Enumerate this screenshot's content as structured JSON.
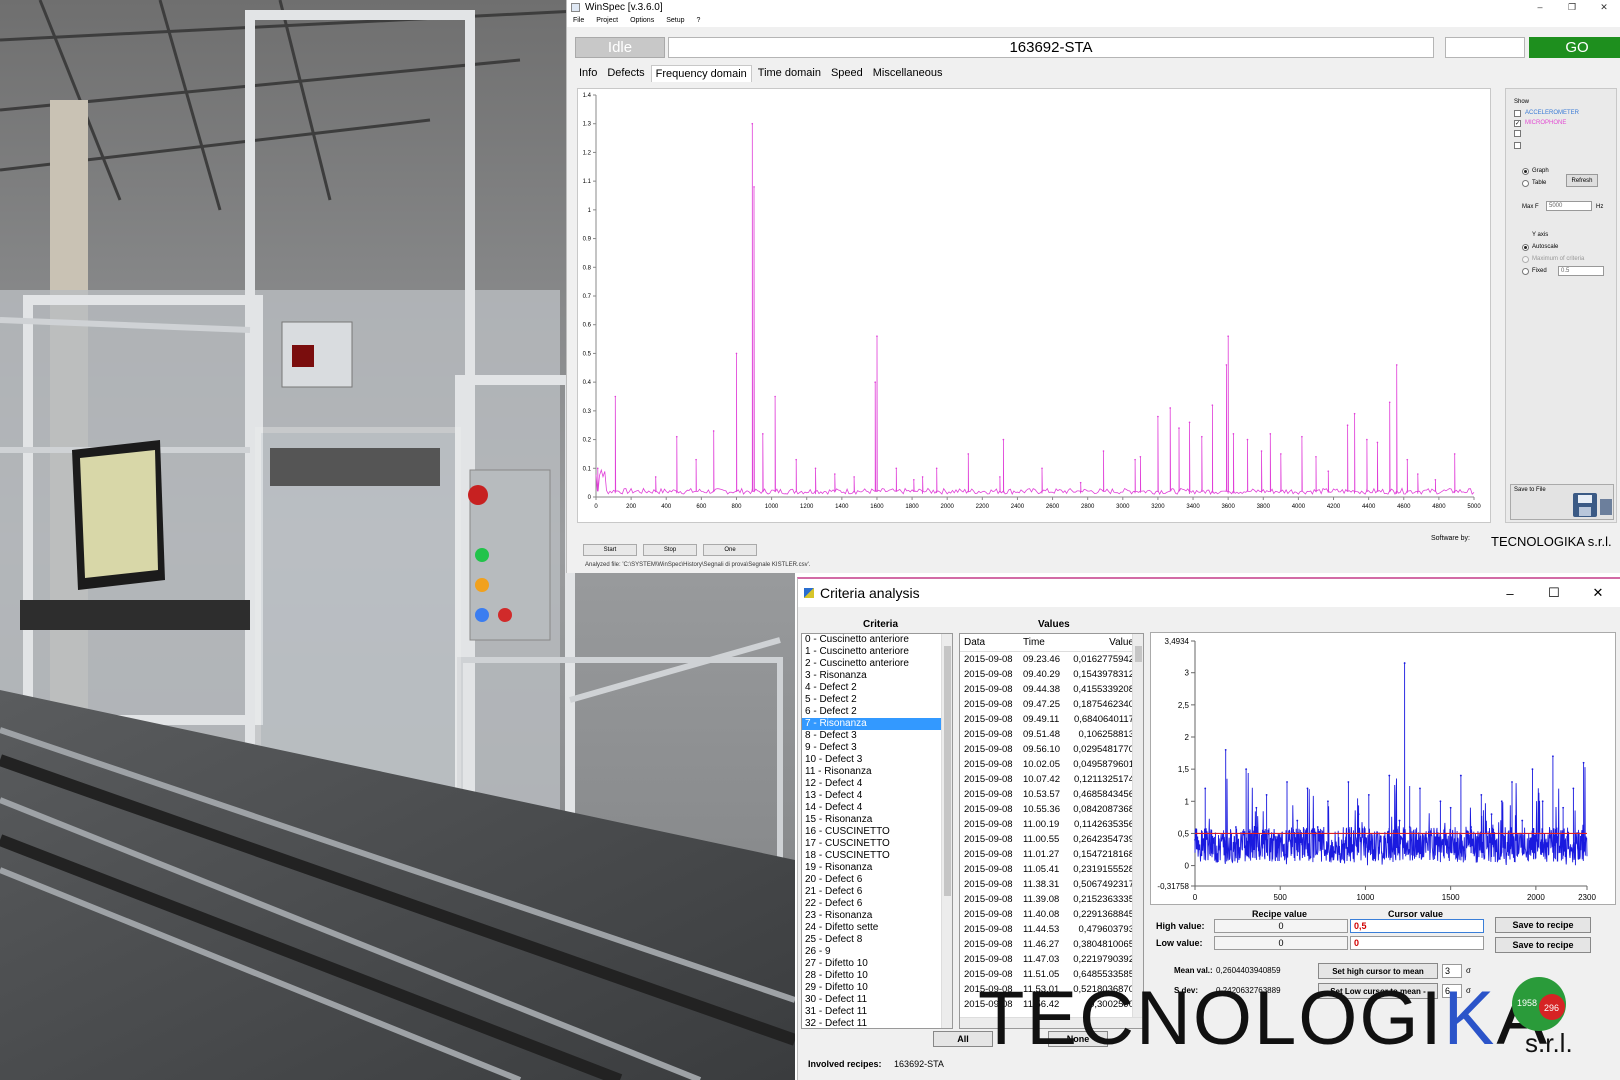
{
  "winspec": {
    "title": "WinSpec [v.3.6.0]",
    "menu": [
      "File",
      "Project",
      "Options",
      "Setup",
      "?"
    ],
    "state": "Idle",
    "recipe": "163692-STA",
    "go_label": "GO",
    "tabs": [
      "Info",
      "Defects",
      "Frequency domain",
      "Time domain",
      "Speed",
      "Miscellaneous"
    ],
    "active_tab": "Frequency domain",
    "side": {
      "show_label": "Show",
      "channels": [
        {
          "label": "ACCELEROMETER",
          "checked": false,
          "color": "#3a7bd5"
        },
        {
          "label": "MICROPHONE",
          "checked": true,
          "color": "#e34bd3"
        },
        {
          "label": "",
          "checked": false
        },
        {
          "label": "",
          "checked": false
        }
      ],
      "graph_label": "Graph",
      "table_label": "Table",
      "refresh_label": "Refresh",
      "max_f_label": "Max F",
      "max_f_value": "5000",
      "max_f_unit": "Hz",
      "yaxis_label": "Y axis",
      "autoscale_label": "Autoscale",
      "maximum_label": "Maximum of criteria",
      "fixed_label": "Fixed",
      "fixed_value": "0.5",
      "save_label": "Save to File"
    },
    "buttons": [
      "Start",
      "Stop",
      "One"
    ],
    "software_by": "Software by:",
    "brand": "TECNOLOGIKA s.r.l.",
    "analyzed_file": "Analyzed file: 'C:\\SYSTEM\\WinSpec\\History\\Segnali di prova\\Segnale KISTLER.csv'."
  },
  "criteria": {
    "title": "Criteria analysis",
    "criteria_header": "Criteria",
    "values_header": "Values",
    "items": [
      "0 - Cuscinetto anteriore",
      "1 - Cuscinetto anteriore",
      "2 - Cuscinetto anteriore",
      "3 - Risonanza",
      "4 - Defect 2",
      "5 - Defect 2",
      "6 - Defect 2",
      "7 - Risonanza",
      "8 - Defect 3",
      "9 - Defect 3",
      "10 - Defect 3",
      "11 - Risonanza",
      "12 - Defect 4",
      "13 - Defect 4",
      "14 - Defect 4",
      "15 - Risonanza",
      "16 - CUSCINETTO",
      "17 - CUSCINETTO",
      "18 - CUSCINETTO",
      "19 - Risonanza",
      "20 - Defect 6",
      "21 - Defect 6",
      "22 - Defect 6",
      "23 - Risonanza",
      "24 - Difetto sette",
      "25 - Defect 8",
      "26 - 9",
      "27 - Difetto 10",
      "28 - Difetto 10",
      "29 - Difetto 10",
      "30 - Defect 11",
      "31 - Defect 11",
      "32 - Defect 11"
    ],
    "selected_index": 7,
    "columns": [
      "Data",
      "Time",
      "Value"
    ],
    "rows": [
      [
        "2015-09-08",
        "09.23.46",
        "0,0162775942"
      ],
      [
        "2015-09-08",
        "09.40.29",
        "0,1543978312"
      ],
      [
        "2015-09-08",
        "09.44.38",
        "0,4155339208"
      ],
      [
        "2015-09-08",
        "09.47.25",
        "0,1875462340"
      ],
      [
        "2015-09-08",
        "09.49.11",
        "0,6840640117"
      ],
      [
        "2015-09-08",
        "09.51.48",
        "0,106258813"
      ],
      [
        "2015-09-08",
        "09.56.10",
        "0,0295481770"
      ],
      [
        "2015-09-08",
        "10.02.05",
        "0,0495879601"
      ],
      [
        "2015-09-08",
        "10.07.42",
        "0,1211325174"
      ],
      [
        "2015-09-08",
        "10.53.57",
        "0,4685843456"
      ],
      [
        "2015-09-08",
        "10.55.36",
        "0,0842087368"
      ],
      [
        "2015-09-08",
        "11.00.19",
        "0,1142635356"
      ],
      [
        "2015-09-08",
        "11.00.55",
        "0,2642354739"
      ],
      [
        "2015-09-08",
        "11.01.27",
        "0,1547218168"
      ],
      [
        "2015-09-08",
        "11.05.41",
        "0,2319155528"
      ],
      [
        "2015-09-08",
        "11.38.31",
        "0,5067492317"
      ],
      [
        "2015-09-08",
        "11.39.08",
        "0,2152363335"
      ],
      [
        "2015-09-08",
        "11.40.08",
        "0,2291368845"
      ],
      [
        "2015-09-08",
        "11.44.53",
        "0,479603793"
      ],
      [
        "2015-09-08",
        "11.46.27",
        "0,3804810065"
      ],
      [
        "2015-09-08",
        "11.47.03",
        "0,2219790392"
      ],
      [
        "2015-09-08",
        "11.51.05",
        "0,6485533585"
      ],
      [
        "2015-09-08",
        "11.53.01",
        "0,5218036870"
      ],
      [
        "2015-09-08",
        "11.56.42",
        "0,3002590"
      ]
    ],
    "recipe_value_header": "Recipe value",
    "cursor_value_header": "Cursor value",
    "high_label": "High value:",
    "low_label": "Low value:",
    "high_recipe": "0",
    "low_recipe": "0",
    "high_cursor": "0,5",
    "low_cursor": "0",
    "save_label": "Save to recipe",
    "mean_label": "Mean val.:",
    "mean_value": "0,2604403940859",
    "sdev_label": "S.dev:",
    "sdev_value": "0,2420632763889",
    "set_high_label": "Set high cursor to mean",
    "set_low_label": "Set Low cursor to mean -",
    "high_sigma": "3",
    "low_sigma": "6",
    "sigma": "σ",
    "all_label": "All",
    "none_label": "None",
    "involved_label": "Involved recipes:",
    "involved_value": "163692-STA"
  },
  "logo": {
    "before_k": "TECNOLOGI",
    "k": "K",
    "after_k": "A",
    "srl": "s.r.l.",
    "seal_left": "1958",
    "seal_right": "296"
  },
  "chart_data": [
    {
      "type": "line",
      "title": "",
      "xlabel": "",
      "ylabel": "",
      "xlim": [
        0,
        5000
      ],
      "ylim": [
        0,
        1.4
      ],
      "x_ticks": [
        0,
        200,
        400,
        600,
        800,
        1000,
        1200,
        1400,
        1600,
        1800,
        2000,
        2200,
        2400,
        2600,
        2800,
        3000,
        3200,
        3400,
        3600,
        3800,
        4000,
        4200,
        4400,
        4600,
        4800,
        5000
      ],
      "y_ticks": [
        "0",
        "0.1",
        "0.2",
        "0.3",
        "0.4",
        "0.5",
        "0.6",
        "0.7",
        "0.8",
        "0.9",
        "1",
        "1.1",
        "1.2",
        "1.3",
        "1.4"
      ],
      "color": "#e040d8",
      "series": [
        {
          "name": "MICROPHONE",
          "x": [
            10,
            110,
            340,
            460,
            570,
            670,
            800,
            890,
            900,
            950,
            1020,
            1140,
            1250,
            1360,
            1470,
            1590,
            1600,
            1710,
            1810,
            1860,
            1940,
            2120,
            2300,
            2320,
            2540,
            2760,
            2890,
            3070,
            3100,
            3200,
            3270,
            3320,
            3380,
            3450,
            3510,
            3590,
            3600,
            3630,
            3710,
            3790,
            3840,
            3900,
            4020,
            4100,
            4170,
            4280,
            4320,
            4390,
            4450,
            4520,
            4560,
            4620,
            4680,
            4780,
            4890
          ],
          "y": [
            0.1,
            0.35,
            0.07,
            0.21,
            0.13,
            0.23,
            0.5,
            1.3,
            1.08,
            0.22,
            0.35,
            0.13,
            0.1,
            0.08,
            0.07,
            0.4,
            0.56,
            0.1,
            0.06,
            0.07,
            0.1,
            0.15,
            0.07,
            0.2,
            0.1,
            0.05,
            0.16,
            0.13,
            0.14,
            0.28,
            0.31,
            0.24,
            0.26,
            0.21,
            0.32,
            0.46,
            0.56,
            0.22,
            0.2,
            0.16,
            0.22,
            0.15,
            0.21,
            0.14,
            0.09,
            0.25,
            0.29,
            0.2,
            0.19,
            0.33,
            0.46,
            0.13,
            0.08,
            0.06,
            0.15
          ]
        }
      ]
    },
    {
      "type": "line",
      "title": "",
      "xlabel": "",
      "ylabel": "",
      "xlim": [
        0,
        2300
      ],
      "ylim": [
        -0.31758,
        3.4934
      ],
      "x_ticks": [
        0,
        500,
        1000,
        1500,
        2000,
        2300
      ],
      "y_ticks": [
        "3,4934",
        "3",
        "2,5",
        "2",
        "1,5",
        "1",
        "0,5",
        "0",
        "-0,31758"
      ],
      "threshold": 0.5,
      "color": "#1a1adf",
      "threshold_color": "#e02020",
      "series": [
        {
          "name": "",
          "x": [
            0,
            60,
            120,
            180,
            240,
            300,
            360,
            420,
            480,
            540,
            600,
            660,
            720,
            780,
            840,
            900,
            960,
            1020,
            1080,
            1140,
            1200,
            1230,
            1260,
            1320,
            1380,
            1440,
            1500,
            1560,
            1620,
            1680,
            1740,
            1800,
            1860,
            1920,
            1980,
            2040,
            2100,
            2160,
            2220,
            2280
          ],
          "y": [
            0.4,
            1.2,
            0.5,
            1.8,
            0.6,
            1.5,
            0.9,
            1.1,
            0.4,
            1.3,
            0.7,
            1.2,
            0.6,
            1.0,
            0.5,
            1.3,
            0.8,
            1.1,
            0.5,
            1.4,
            0.7,
            3.15,
            0.6,
            1.2,
            0.5,
            1.0,
            0.9,
            1.4,
            0.6,
            1.1,
            0.8,
            1.0,
            1.3,
            0.7,
            1.5,
            1.0,
            1.7,
            0.9,
            1.2,
            1.6
          ]
        }
      ]
    }
  ]
}
